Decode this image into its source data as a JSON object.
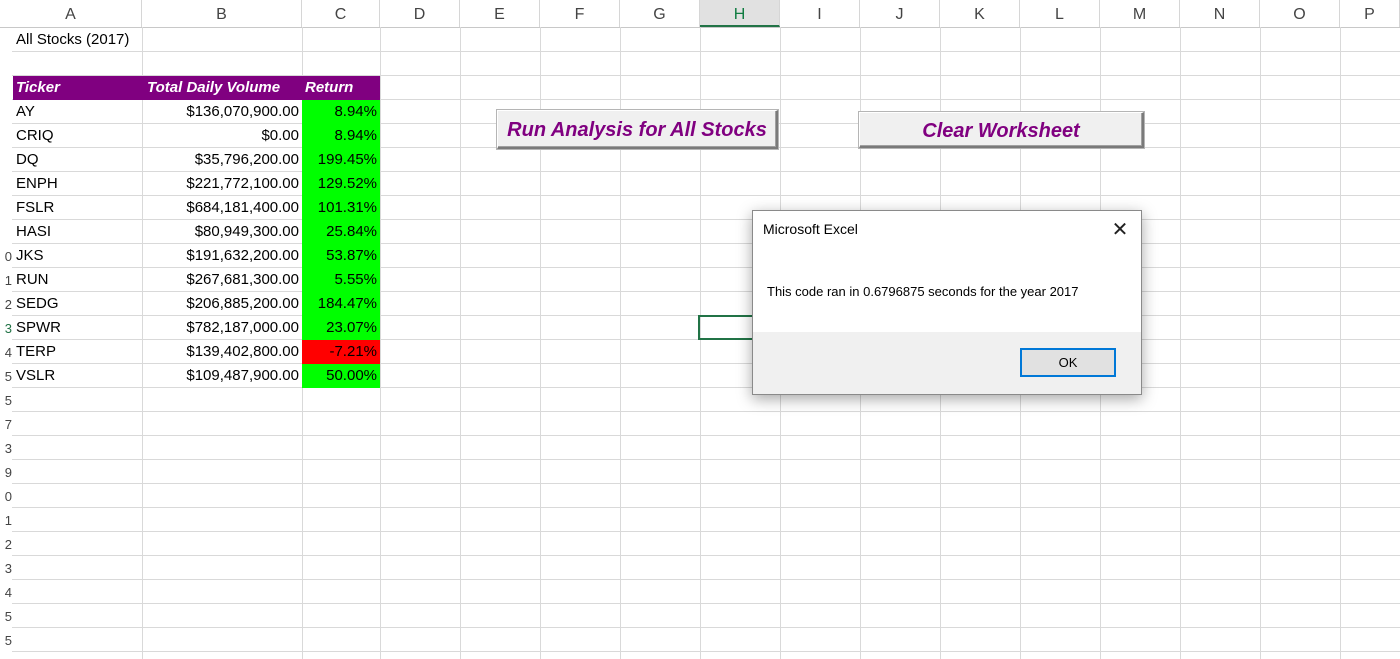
{
  "columns": [
    "A",
    "B",
    "C",
    "D",
    "E",
    "F",
    "G",
    "H",
    "I",
    "J",
    "K",
    "L",
    "M",
    "N",
    "O",
    "P"
  ],
  "selected_column": "H",
  "row_numbers": [
    "0",
    "1",
    "2",
    "3",
    "4",
    "5",
    "5",
    "7",
    "3",
    "9",
    "0",
    "1",
    "2",
    "3",
    "4",
    "5",
    "5"
  ],
  "sheet": {
    "title": "All Stocks (2017)",
    "headers": {
      "ticker": "Ticker",
      "volume": "Total Daily Volume",
      "return": "Return"
    },
    "rows": [
      {
        "ticker": "AY",
        "volume": "$136,070,900.00",
        "return": "8.94%",
        "status": "positive"
      },
      {
        "ticker": "CRIQ",
        "volume": "$0.00",
        "return": "8.94%",
        "status": "positive"
      },
      {
        "ticker": "DQ",
        "volume": "$35,796,200.00",
        "return": "199.45%",
        "status": "positive"
      },
      {
        "ticker": "ENPH",
        "volume": "$221,772,100.00",
        "return": "129.52%",
        "status": "positive"
      },
      {
        "ticker": "FSLR",
        "volume": "$684,181,400.00",
        "return": "101.31%",
        "status": "positive"
      },
      {
        "ticker": "HASI",
        "volume": "$80,949,300.00",
        "return": "25.84%",
        "status": "positive"
      },
      {
        "ticker": "JKS",
        "volume": "$191,632,200.00",
        "return": "53.87%",
        "status": "positive"
      },
      {
        "ticker": "RUN",
        "volume": "$267,681,300.00",
        "return": "5.55%",
        "status": "positive"
      },
      {
        "ticker": "SEDG",
        "volume": "$206,885,200.00",
        "return": "184.47%",
        "status": "positive"
      },
      {
        "ticker": "SPWR",
        "volume": "$782,187,000.00",
        "return": "23.07%",
        "status": "positive"
      },
      {
        "ticker": "TERP",
        "volume": "$139,402,800.00",
        "return": "-7.21%",
        "status": "negative"
      },
      {
        "ticker": "VSLR",
        "volume": "$109,487,900.00",
        "return": "50.00%",
        "status": "positive"
      }
    ]
  },
  "buttons": {
    "run_analysis": "Run Analysis for All Stocks",
    "clear_worksheet": "Clear Worksheet"
  },
  "dialog": {
    "title": "Microsoft Excel",
    "message": "This code ran in 0.6796875 seconds for the year 2017",
    "ok_label": "OK",
    "close_glyph": "✕"
  },
  "colors": {
    "header_fill": "#800080",
    "positive_fill": "#00ff00",
    "negative_fill": "#ff0000",
    "button_text": "#800080",
    "selection": "#217346"
  }
}
